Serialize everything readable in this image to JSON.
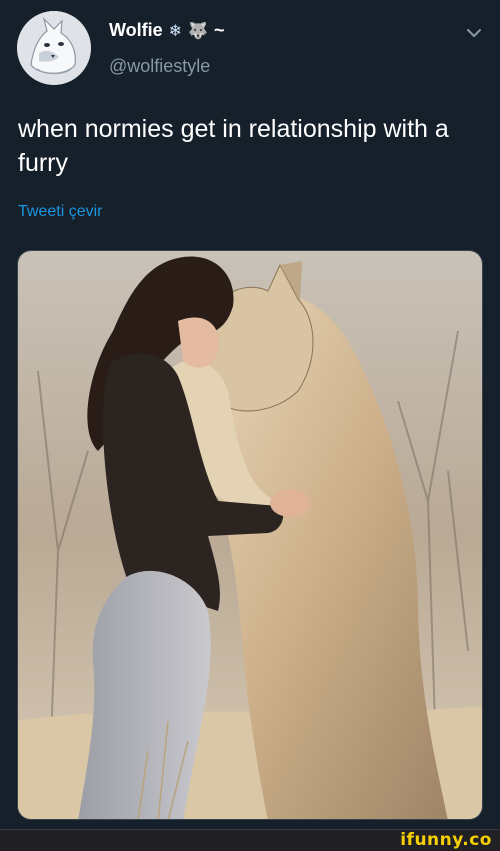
{
  "tweet": {
    "display_name": "Wolfie",
    "name_emoji_1": "❄",
    "name_emoji_2": "🐺",
    "name_suffix": "~",
    "handle": "@wolfiestyle",
    "text": "when normies get in relationship with a furry",
    "translate_label": "Tweeti çevir",
    "avatar_icon": "wolf-avatar",
    "menu_icon": "chevron-down-icon"
  },
  "media": {
    "icon": "photo-woman-hugging-wolf"
  },
  "watermark": {
    "text": "ifunny.co"
  },
  "colors": {
    "background": "#15202b",
    "text_primary": "#ffffff",
    "text_secondary": "#8899a6",
    "link": "#1b95e0",
    "watermark": "#f5d000"
  }
}
